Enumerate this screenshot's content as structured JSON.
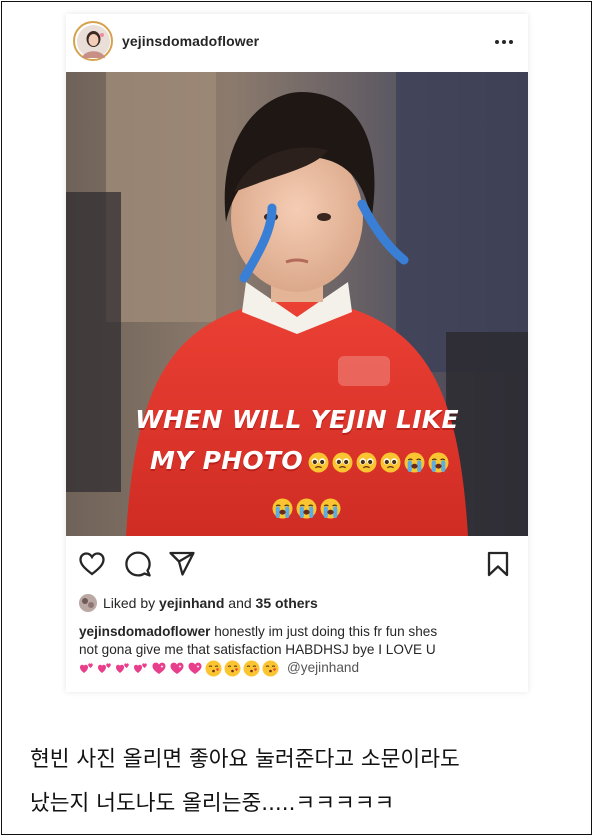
{
  "post": {
    "username": "yejinsdomadoflower",
    "more_icon": "more-horizontal-icon",
    "photo_caption": {
      "line1": "WHEN WILL YEJIN LIKE",
      "line2": "MY PHOTO"
    },
    "likes": {
      "prefix": "Liked by",
      "liker": "yejinhand",
      "joiner": "and",
      "others": "35 others"
    },
    "caption": {
      "author": "yejinsdomadoflower",
      "text_line1": "honestly im just doing this fr fun shes",
      "text_line2": "not gona give me that satisfaction HABDHSJ bye I LOVE U",
      "mention": "@yejinhand"
    },
    "action_icons": [
      "heart-icon",
      "comment-icon",
      "share-icon",
      "bookmark-icon"
    ]
  },
  "comment": {
    "line1": "현빈 사진 올리면 좋아요 눌러준다고 소문이라도",
    "line2": "났는지 너도나도 올리는중.....ㅋㅋㅋㅋㅋ"
  },
  "colors": {
    "sweater_red": "#e0362c",
    "tear_blue": "#3a7fd6",
    "avatar_ring": "#d7a24f",
    "heart_pink": "#e83e8c"
  }
}
